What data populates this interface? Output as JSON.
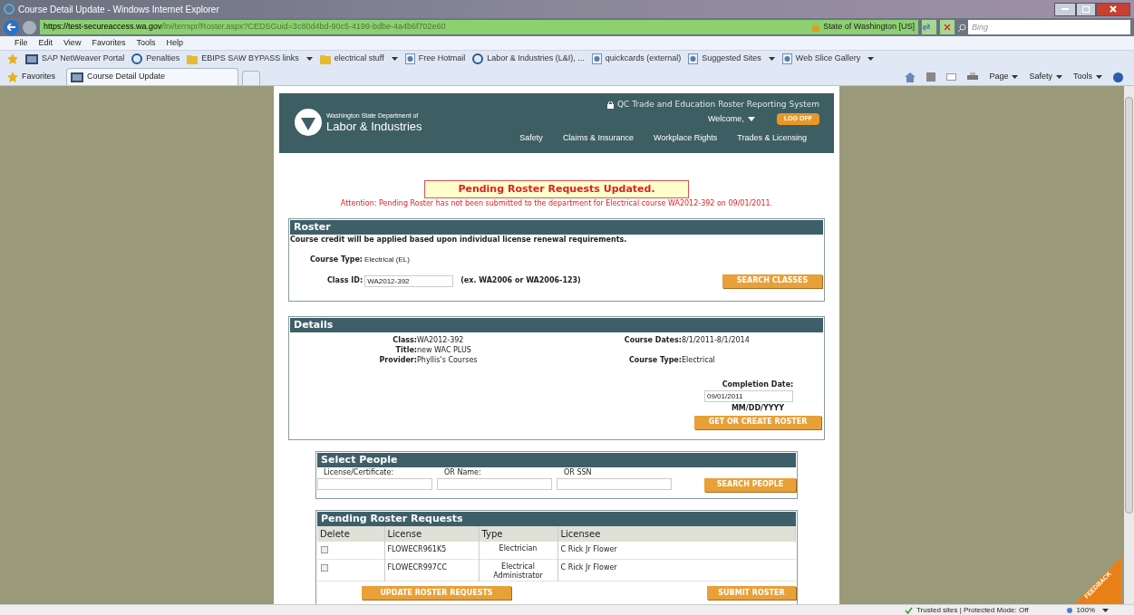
{
  "window": {
    "title": "Course Detail Update - Windows Internet Explorer"
  },
  "address_bar": {
    "scheme": "https://",
    "host": "test-secureaccess.wa.gov",
    "path": "/lni/terrspr/Roster.aspx?CEDSGuid=3c80d4bd-90c5-4199-bdbe-4a4b6f702e60",
    "certificate": "State of Washington [US]"
  },
  "search": {
    "placeholder": "Bing"
  },
  "menu": [
    "File",
    "Edit",
    "View",
    "Favorites",
    "Tools",
    "Help"
  ],
  "favorites_bar": [
    {
      "label": "SAP NetWeaver Portal",
      "kind": "site",
      "dropdown": false
    },
    {
      "label": "Penalties",
      "kind": "logo",
      "dropdown": false
    },
    {
      "label": "EBIPS SAW BYPASS links",
      "kind": "folder",
      "dropdown": true
    },
    {
      "label": "electrical stuff",
      "kind": "folder",
      "dropdown": true
    },
    {
      "label": "Free Hotmail",
      "kind": "page",
      "dropdown": false
    },
    {
      "label": "Labor & Industries (L&I), ...",
      "kind": "logo",
      "dropdown": false
    },
    {
      "label": "quickcards (external)",
      "kind": "page",
      "dropdown": false
    },
    {
      "label": "Suggested Sites",
      "kind": "page",
      "dropdown": true
    },
    {
      "label": "Web Slice Gallery",
      "kind": "page",
      "dropdown": true
    }
  ],
  "favorites_button": "Favorites",
  "tabs": [
    {
      "label": "Course Detail Update",
      "selected": true
    }
  ],
  "command_bar": [
    "Page",
    "Safety",
    "Tools"
  ],
  "site_header": {
    "department": "Washington State Department of",
    "name": "Labor & Industries",
    "system": "QC Trade and Education Roster Reporting System",
    "welcome": "Welcome,",
    "logoff": "LOG OFF",
    "nav": [
      "Safety",
      "Claims & Insurance",
      "Workplace Rights",
      "Trades & Licensing"
    ]
  },
  "message": {
    "title": "Pending Roster Requests Updated.",
    "attention": "Attention: Pending Roster has not been submitted to the department for Electrical course WA2012-392 on 09/01/2011."
  },
  "roster": {
    "heading": "Roster",
    "note": "Course credit will be applied based upon individual license renewal requirements.",
    "course_type_label": "Course Type:",
    "course_type": "Electrical (EL)",
    "class_id_label": "Class ID:",
    "class_id": "WA2012-392",
    "hint": "(ex. WA2006 or WA2006-123)",
    "button": "SEARCH CLASSES"
  },
  "details": {
    "heading": "Details",
    "left": [
      {
        "label": "Class:",
        "value": "WA2012-392"
      },
      {
        "label": "Title:",
        "value": "new WAC PLUS"
      },
      {
        "label": "Provider:",
        "value": "Phyllis's Courses"
      }
    ],
    "right": [
      {
        "label": "Course Dates:",
        "value": "8/1/2011-8/1/2014"
      },
      {
        "label": "Course Type:",
        "value": "Electrical"
      }
    ],
    "completion_label": "Completion Date:",
    "completion_date": "09/01/2011",
    "format": "MM/DD/YYYY",
    "button": "GET OR CREATE ROSTER"
  },
  "select_people": {
    "heading": "Select People",
    "fields": [
      "License/Certificate:",
      "OR Name:",
      "OR SSN"
    ],
    "button": "SEARCH PEOPLE"
  },
  "pending": {
    "heading": "Pending Roster Requests",
    "columns": [
      "Delete",
      "License",
      "Type",
      "Licensee"
    ],
    "rows": [
      {
        "checked": false,
        "license": "FLOWECR961K5",
        "type": "Electrician",
        "licensee": "C Rick Jr Flower"
      },
      {
        "checked": false,
        "license": "FLOWECR997CC",
        "type": "Electrical Administrator",
        "licensee": "C Rick Jr Flower"
      }
    ],
    "buttons": [
      "UPDATE ROSTER REQUESTS",
      "SUBMIT ROSTER"
    ]
  },
  "feedback": "FEEDBACK",
  "status_bar": {
    "zone": "Trusted sites | Protected Mode: Off",
    "zoom": "100%"
  }
}
